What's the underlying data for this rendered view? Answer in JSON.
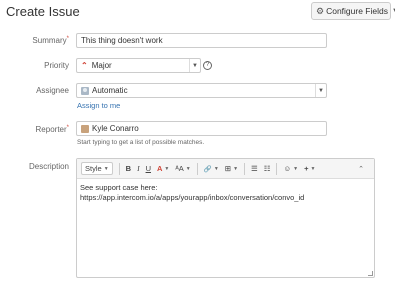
{
  "header": {
    "title": "Create Issue",
    "configure_fields_label": "Configure Fields"
  },
  "fields": {
    "summary": {
      "label": "Summary",
      "value": "This thing doesn't work"
    },
    "priority": {
      "label": "Priority",
      "value": "Major",
      "icon": "double-chevron-up-icon"
    },
    "assignee": {
      "label": "Assignee",
      "value": "Automatic",
      "assign_to_me": "Assign to me"
    },
    "reporter": {
      "label": "Reporter",
      "value": "Kyle Conarro",
      "hint": "Start typing to get a list of possible matches."
    },
    "description": {
      "label": "Description",
      "line1": "See support case here:",
      "line2": "https://app.intercom.io/a/apps/yourapp/inbox/conversation/convo_id"
    }
  },
  "toolbar": {
    "style_label": "Style",
    "bold": "B",
    "italic": "I",
    "underline": "U",
    "color": "A",
    "text_size": "ᴬA",
    "link": "🔗",
    "attach": "⊞",
    "list_bullets": "☰",
    "list_numbers": "☷",
    "emoticon": "☺",
    "insert": "+",
    "collapse": "⌃"
  },
  "colors": {
    "required": "#d04437",
    "link": "#3572b0",
    "priority_icon": "#d04437"
  }
}
